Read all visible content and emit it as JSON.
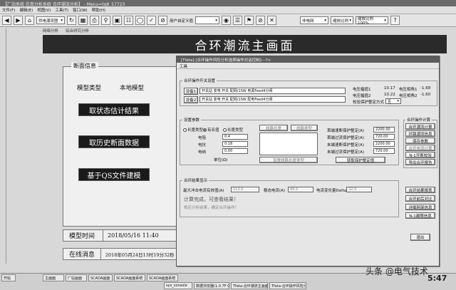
{
  "app": {
    "title": "【厂站系统 仿真分析系统 合环潮流分析】 - Menu=tq8_57723"
  },
  "menubar": [
    "文件(F)",
    "编辑(E)",
    "视图(V)",
    "工具(T)",
    "窗口(W)",
    "帮助(H)"
  ],
  "toolbar": {
    "combo1": "供电潮流图",
    "user_label": "用户自定义值",
    "combo2": "非电网",
    "combo3": "缩放比例",
    "combo4": "缩放比例 100%"
  },
  "breadcrumbs": [
    "网络分析",
    "综合研究分析"
  ],
  "banner_title": "合环潮流主画面",
  "left_panel": {
    "caption": "断面信息",
    "model_type_label": "模型类型",
    "model_type_value": "本地模型",
    "btn_state_est": "取状态估计结果",
    "btn_history": "取历史断面数据",
    "btn_qs_file": "基于QS文件建模"
  },
  "info": {
    "model_time_label": "模型时间",
    "model_time_value": "2018/05/16 11:40",
    "online_msg_label": "在线消息",
    "online_msg_value": "2018年05月24日13时19分32秒 t/s"
  },
  "dialog": {
    "title": "[Tfeta]-[合环操作风险分析选择操作对话控制]---?>",
    "menu": "工具",
    "section_breaker": "合环操作开关设置",
    "switch1_btn": "设备1",
    "switch1_value": "开关站 变电 开关 配网/1SW 电源Feed4分闸",
    "switch2_btn": "设备2",
    "switch2_value": "开关站 变电 开关 配网/1SW 配电Feed4分闸",
    "voltage_amp1_label": "电压幅值1",
    "voltage_amp1_value": "10.17",
    "voltage_amp2_label": "电压幅值2",
    "voltage_amp2_value": "10.22",
    "phase1_label": "电压相角1",
    "phase1_value": "-1.68",
    "phase2_label": "电压相角2",
    "phase2_value": "-1.60",
    "check_label": "校验保护整定方式",
    "check_value": "否",
    "section_params": "设置参数",
    "radio_lbl_a": "长度类型",
    "radio_lbl_b": "有名值",
    "radio_lbl_c": "长度类型",
    "param_r_label": "电阻",
    "param_r_value": "0.4",
    "param_x_label": "电抗",
    "param_x_value": "0.18",
    "param_b_label": "电纳",
    "param_b_value": "0.00",
    "unit_label": "单位(Ω)",
    "line_len_btn": "线路长度",
    "line_type_btn": "线路类型",
    "set_line_btn": "设置线路长度类型",
    "prot1_label": "首端速断保护整定(A)",
    "prot1_value": "2200.00",
    "prot2_label": "首端过流保护整定(A)",
    "prot2_value": "720.00",
    "prot3_label": "末端速断保护整定(A)",
    "prot3_value": "2200.00",
    "prot4_label": "末端过流保护整定(A)",
    "prot4_value": "720.00",
    "get_prot_btn": "获取保护整定值",
    "section_result": "合环结果显示",
    "max_current_label": "最大冲击电流有效值(A)",
    "max_current_value": "113.0",
    "steady_current_label": "稳态电流(A)",
    "steady_current_value": "49.5",
    "delta_label": "电流变化量Delta",
    "delta_value": "32.5",
    "calc_done": "计算完成，可查看结果！",
    "calc_hint": "相应分析结果，确定合环操作！",
    "section_ops": "合环操作计算",
    "op_btns": [
      "合环潮流计算",
      "环路潮流信息",
      "保存参数",
      "合环电流计算",
      "N-1开断校验",
      "导出合环报告"
    ],
    "bottom_btns": [
      "合环结果报表",
      "合环前后对比",
      "详细网架信息",
      "N-1越限信息"
    ],
    "exit_btn": "退出"
  },
  "taskbar": {
    "start": "开始",
    "tasks_row1": [
      "主画面",
      "厂站画面",
      "SCADA画面",
      "SCADA画面系统",
      "SCADA画面系统"
    ],
    "tasks_row2": [
      "sys_console",
      "数据浏览器(1.0.7F CL)",
      "Tfeta-合环潮流主画面",
      "Tfeta-合环操作风险分析"
    ],
    "clock": "5:47"
  },
  "watermark": "头条 @电气技术",
  "colors": {
    "banner": "#2a2a2a",
    "dark_button": "#1a1a1a",
    "dialog_title": "#5c5c5c"
  }
}
